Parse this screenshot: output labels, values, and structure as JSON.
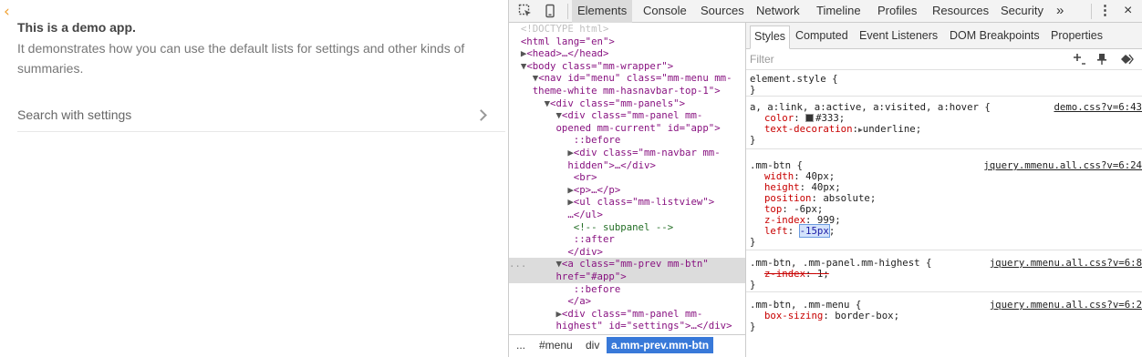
{
  "app": {
    "back_glyph": "‹",
    "title": "This is a demo app.",
    "description": "It demonstrates how you can use the default lists for settings and other kinds of summaries.",
    "row_label": "Search with settings"
  },
  "devtools": {
    "tabs": [
      "Elements",
      "Console",
      "Sources",
      "Network",
      "Timeline",
      "Profiles",
      "Resources",
      "Security"
    ],
    "active_tab": "Elements",
    "more_tabs_glyph": "»",
    "menu_glyph": "⋮",
    "close_glyph": "×",
    "subtabs": [
      "Styles",
      "Computed",
      "Event Listeners",
      "DOM Breakpoints",
      "Properties"
    ],
    "filter_placeholder": "Filter",
    "dom_tree": {
      "doctype": "<!DOCTYPE html>",
      "html_open": "<html lang=\"en\">",
      "head": "<head>…</head>",
      "body_open": "<body class=\"mm-wrapper\">",
      "nav_1": "<nav id=\"menu\" class=\"mm-menu mm-",
      "nav_2": "theme-white mm-hasnavbar-top-1\">",
      "div_panels": "<div class=\"mm-panels\">",
      "panel_1": "<div class=\"mm-panel mm-",
      "panel_2": "opened mm-current\" id=\"app\">",
      "before_1": "::before",
      "navbar_1": "<div class=\"mm-navbar mm-",
      "navbar_2": "hidden\">…</div>",
      "br": "<br>",
      "p": "<p>…</p>",
      "ul_1": "<ul class=\"mm-listview\">",
      "ul_2": "…</ul>",
      "comment": "<!-- subpanel -->",
      "after": "::after",
      "div_close": "</div>",
      "a_1": "<a class=\"mm-prev mm-btn\"",
      "a_2": "href=\"#app\">",
      "before_2": "::before",
      "a_close": "</a>",
      "panel_h_1": "<div class=\"mm-panel mm-",
      "panel_h_2": "highest\" id=\"settings\">…</div>",
      "selected_marker": "..."
    },
    "breadcrumbs": [
      "...",
      "#menu",
      "div",
      "a.mm-prev.mm-btn"
    ],
    "styles": {
      "element_style": "element.style {",
      "rule1": {
        "selector": "a, a:link, a:active, a:visited, a:hover {",
        "source": "demo.css?v=6:43",
        "props": [
          {
            "name": "color",
            "value": "#333;"
          },
          {
            "name": "text-decoration",
            "value": "underline;"
          }
        ]
      },
      "rule2": {
        "selector": ".mm-btn {",
        "source": "jquery.mmenu.all.css?v=6:24",
        "props": [
          {
            "name": "width",
            "value": "40px;"
          },
          {
            "name": "height",
            "value": "40px;"
          },
          {
            "name": "position",
            "value": "absolute;"
          },
          {
            "name": "top",
            "value": "-6px;"
          },
          {
            "name": "z-index",
            "value": "999;"
          },
          {
            "name": "left",
            "value": "-15px"
          }
        ]
      },
      "rule3": {
        "selector": ".mm-btn, .mm-panel.mm-highest {",
        "source": "jquery.mmenu.all.css?v=6:8",
        "props": [
          {
            "name": "z-index",
            "value": "1;"
          }
        ]
      },
      "rule4": {
        "selector": ".mm-btn, .mm-menu {",
        "source": "jquery.mmenu.all.css?v=6:2",
        "props": [
          {
            "name": "box-sizing",
            "value": "border-box;"
          }
        ]
      },
      "close_brace": "}"
    }
  }
}
